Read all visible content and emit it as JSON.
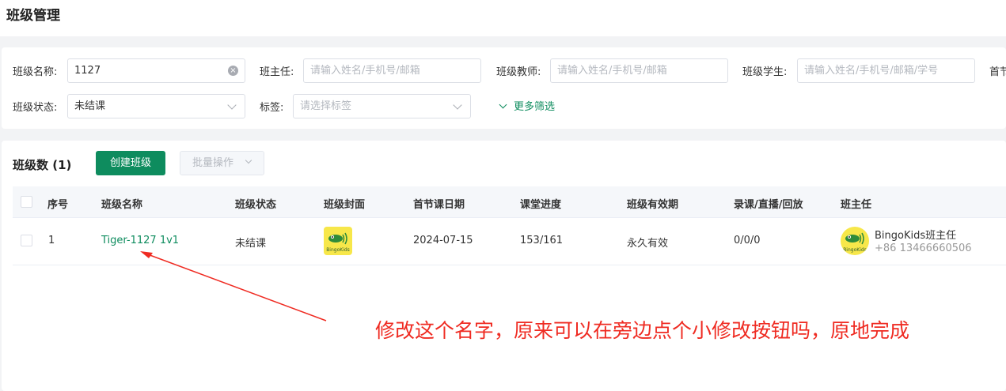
{
  "page": {
    "title": "班级管理"
  },
  "filters": {
    "class_name": {
      "label": "班级名称:",
      "value": "1127"
    },
    "head_teacher": {
      "label": "班主任:",
      "placeholder": "请输入姓名/手机号/邮箱"
    },
    "class_teacher": {
      "label": "班级教师:",
      "placeholder": "请输入姓名/手机号/邮箱"
    },
    "class_student": {
      "label": "班级学生:",
      "placeholder": "请输入姓名/手机号/邮箱/学号"
    },
    "truncated_label": "首节",
    "class_status": {
      "label": "班级状态:",
      "value": "未结课"
    },
    "tags": {
      "label": "标签:",
      "placeholder": "请选择标签"
    },
    "more_filters": "更多筛选"
  },
  "list": {
    "count_label": "班级数 (1)",
    "create_button": "创建班级",
    "batch_button": "批量操作"
  },
  "table": {
    "headers": [
      "序号",
      "班级名称",
      "班级状态",
      "班级封面",
      "首节课日期",
      "课堂进度",
      "班级有效期",
      "录课/直播/回放",
      "班主任"
    ],
    "rows": [
      {
        "index": "1",
        "name": "Tiger-1127 1v1",
        "status": "未结课",
        "cover_text": "BingoKids",
        "first_date": "2024-07-15",
        "progress": "153/161",
        "validity": "永久有效",
        "record_live_replay": "0/0/0",
        "head_teacher_name": "BingoKids班主任",
        "head_teacher_phone": "+86 13466660506"
      }
    ]
  },
  "annotation": {
    "text": "修改这个名字，原来可以在旁边点个小修改按钮吗，原地完成",
    "color": "#ef2b22"
  },
  "colors": {
    "accent": "#0e8c5e",
    "annotation": "#ef2b22"
  }
}
